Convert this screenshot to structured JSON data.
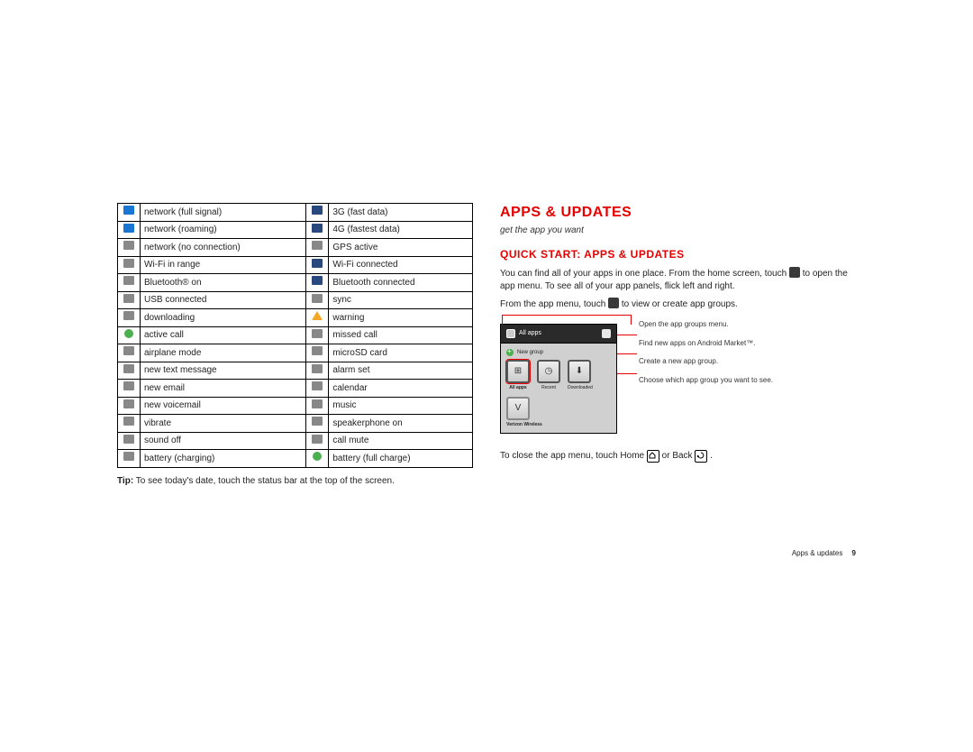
{
  "status_rows": [
    {
      "l_icon": "blue",
      "l": "network (full signal)",
      "r_icon": "navy",
      "r": "3G (fast data)"
    },
    {
      "l_icon": "blue",
      "l": "network (roaming)",
      "r_icon": "navy",
      "r": "4G (fastest data)"
    },
    {
      "l_icon": "gray",
      "l": "network (no connection)",
      "r_icon": "gray",
      "r": "GPS active"
    },
    {
      "l_icon": "gray",
      "l": "Wi-Fi in range",
      "r_icon": "navy",
      "r": "Wi-Fi connected"
    },
    {
      "l_icon": "gray",
      "l": "Bluetooth® on",
      "r_icon": "navy",
      "r": "Bluetooth connected"
    },
    {
      "l_icon": "gray",
      "l": "USB connected",
      "r_icon": "gray",
      "r": "sync"
    },
    {
      "l_icon": "gray",
      "l": "downloading",
      "r_icon": "tri",
      "r": "warning"
    },
    {
      "l_icon": "green",
      "l": "active call",
      "r_icon": "gray",
      "r": "missed call"
    },
    {
      "l_icon": "gray",
      "l": "airplane mode",
      "r_icon": "gray",
      "r": "microSD card"
    },
    {
      "l_icon": "gray",
      "l": "new text message",
      "r_icon": "gray",
      "r": "alarm set"
    },
    {
      "l_icon": "gray",
      "l": "new email",
      "r_icon": "gray",
      "r": "calendar"
    },
    {
      "l_icon": "gray",
      "l": "new voicemail",
      "r_icon": "gray",
      "r": "music"
    },
    {
      "l_icon": "gray",
      "l": "vibrate",
      "r_icon": "gray",
      "r": "speakerphone on"
    },
    {
      "l_icon": "gray",
      "l": "sound off",
      "r_icon": "gray",
      "r": "call mute"
    },
    {
      "l_icon": "gray",
      "l": "battery (charging)",
      "r_icon": "green",
      "r": "battery (full charge)"
    }
  ],
  "tip_label": "Tip:",
  "tip_text": "To see today's date, touch the status bar at the top of the screen.",
  "heading": "Apps & updates",
  "subtitle": "get the app you want",
  "quick_heading": "Quick start: Apps & updates",
  "para1_a": "You can find all of your apps in one place. From the home screen, touch ",
  "para1_b": " to open the app menu. To see all of your app panels, flick left and right.",
  "para2_a": "From the app menu, touch ",
  "para2_b": " to view or create app groups.",
  "shot": {
    "bar_label": "All apps",
    "new_group": "New group",
    "tabs": [
      "All apps",
      "Recent",
      "Downloaded"
    ],
    "row2_label": "Verizon Wireless"
  },
  "callouts": [
    "Open the app groups menu.",
    "Find new apps on Android Market™.",
    "Create a new app group.",
    "Choose which app group you want to see."
  ],
  "close_a": "To close the app menu, touch Home ",
  "close_b": " or Back ",
  "close_c": ".",
  "footer_label": "Apps & updates",
  "footer_page": "9"
}
